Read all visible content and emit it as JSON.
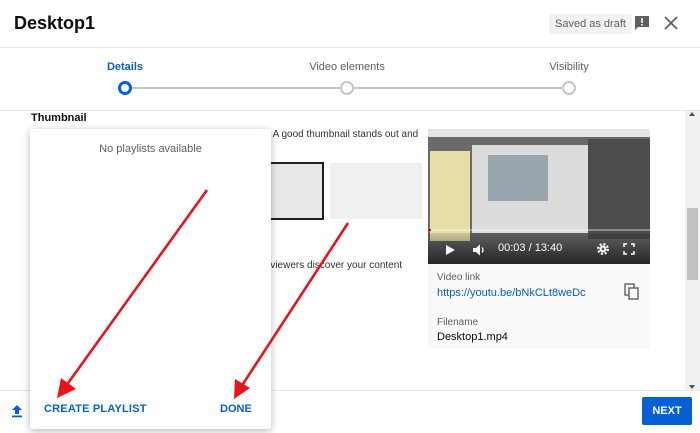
{
  "header": {
    "title": "Desktop1",
    "draft_status": "Saved as draft",
    "icons": {
      "feedback": "feedback-icon",
      "close": "close-icon"
    }
  },
  "stepper": {
    "steps": [
      {
        "label": "Details",
        "active": true
      },
      {
        "label": "Video elements",
        "active": false
      },
      {
        "label": "Visibility",
        "active": false
      }
    ]
  },
  "content": {
    "section_title": "Thumbnail",
    "thumbnail_help_fragment": "o. A good thumbnail stands out and",
    "playlist_help_fragment": "o viewers discover your content"
  },
  "video": {
    "time_display": "00:03 / 13:40",
    "progress_fraction": 0.004,
    "link_label": "Video link",
    "link_url": "https://youtu.be/bNkCLt8weDc",
    "filename_label": "Filename",
    "filename": "Desktop1.mp4",
    "icons": {
      "play": "play-icon",
      "volume": "volume-icon",
      "settings": "settings-icon",
      "fullscreen": "fullscreen-icon",
      "copy": "copy-icon"
    }
  },
  "playlist_dialog": {
    "empty_message": "No playlists available",
    "create_label": "CREATE PLAYLIST",
    "done_label": "DONE"
  },
  "footer": {
    "next_label": "NEXT",
    "upload_icon": "upload-icon"
  },
  "colors": {
    "accent": "#065fd4",
    "annotation_arrow": "#e8141a",
    "progress": "#ff0000"
  }
}
